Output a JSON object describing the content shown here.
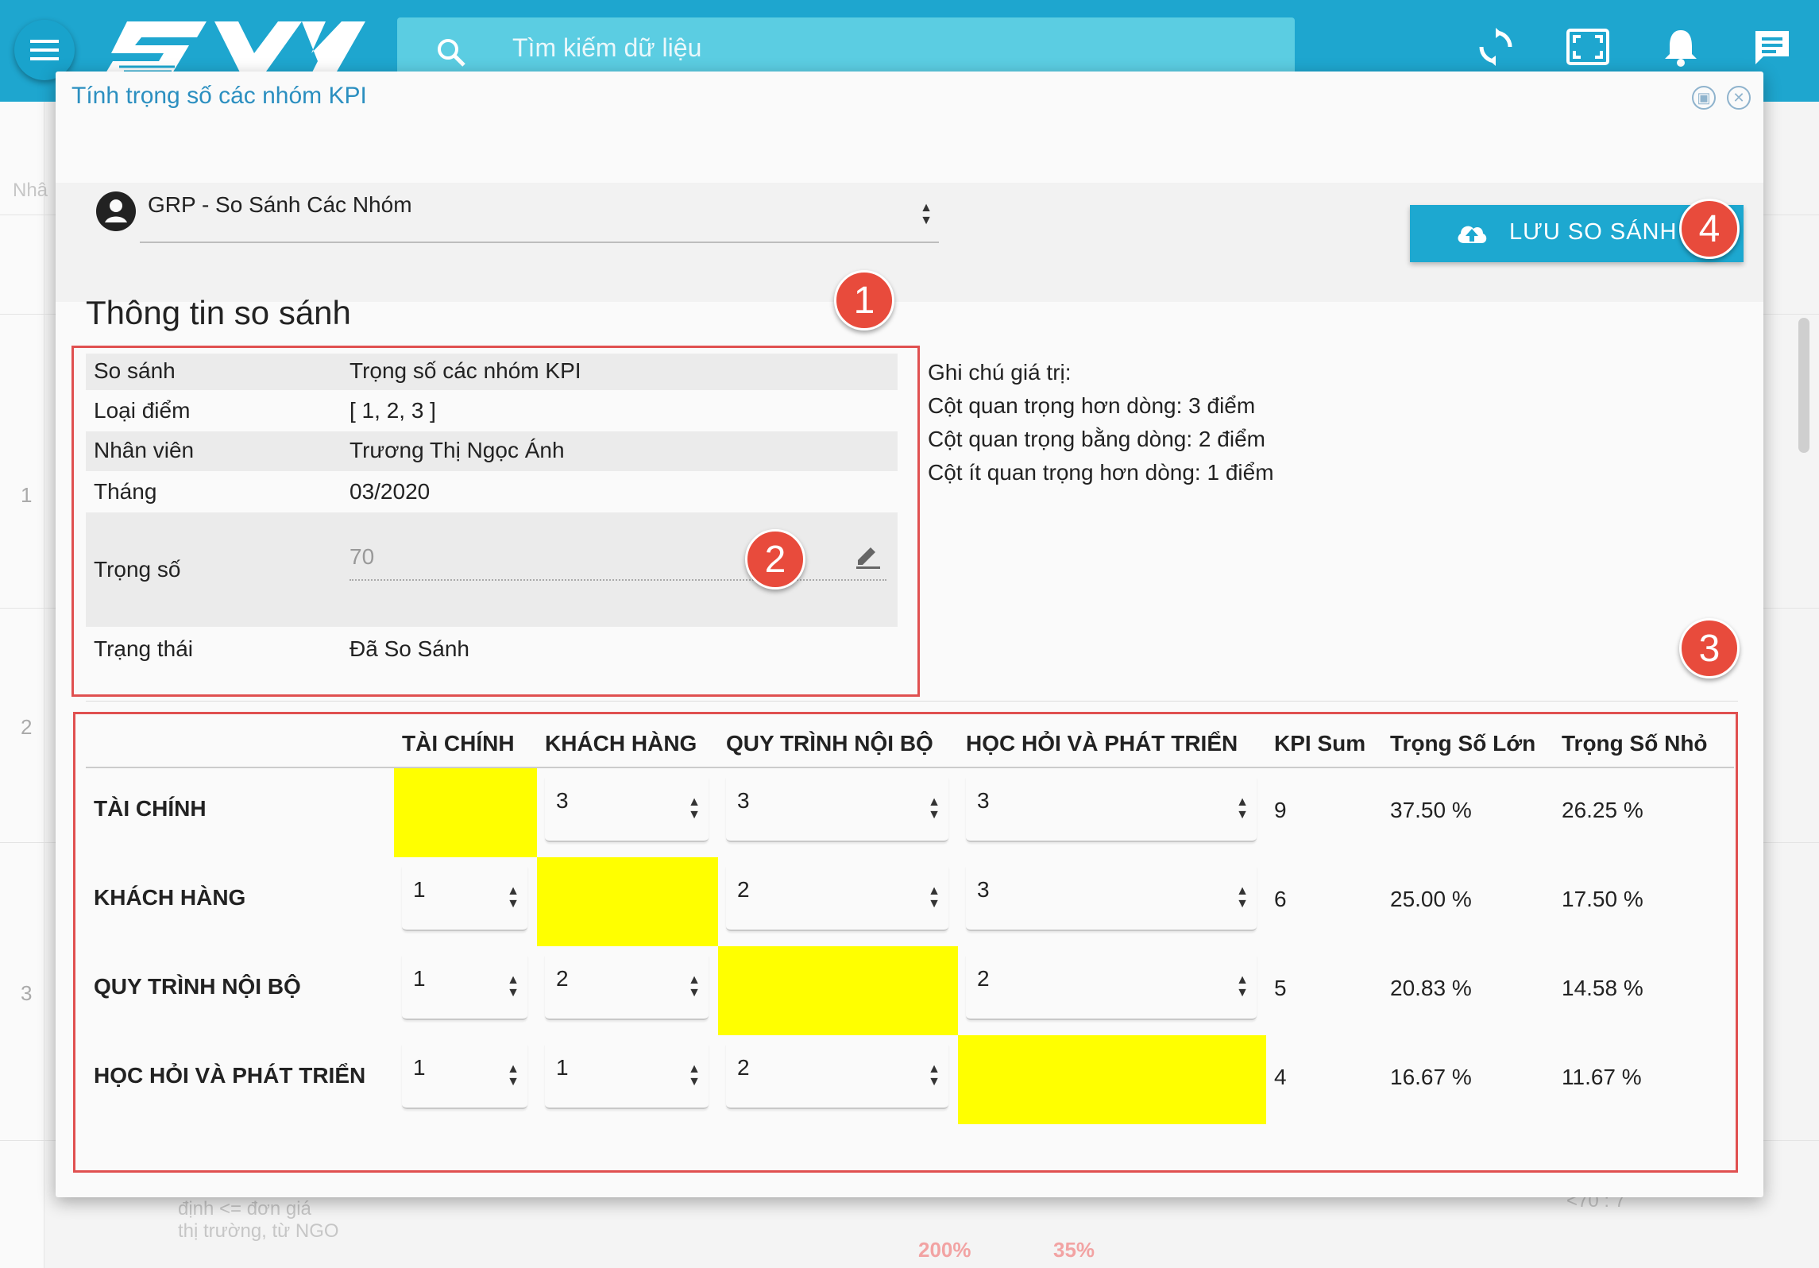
{
  "header": {
    "search_placeholder": "Tìm kiếm dữ liệu",
    "icons": [
      "menu-icon",
      "refresh-icon",
      "fullscreen-icon",
      "bell-icon",
      "chat-icon"
    ]
  },
  "background": {
    "row_numbers": [
      "1",
      "2",
      "3"
    ],
    "partial_label": "Nhâ",
    "footer_texts": [
      "định <= đơn giá",
      "thị trường, từ NGO"
    ],
    "right_partial": "<70 : 7",
    "percentages": [
      "200%",
      "35%"
    ]
  },
  "modal": {
    "title": "Tính trọng số các nhóm KPI",
    "group_select": "GRP - So Sánh Các Nhóm",
    "save_button": "LƯU SO SÁNH",
    "section_title": "Thông tin so sánh",
    "info": {
      "compare_label": "So sánh",
      "compare_value": "Trọng số các nhóm KPI",
      "score_type_label": "Loại điểm",
      "score_type_value": "[ 1, 2, 3 ]",
      "employee_label": "Nhân viên",
      "employee_value": "Trương Thị Ngọc Ánh",
      "month_label": "Tháng",
      "month_value": "03/2020",
      "weight_label": "Trọng số",
      "weight_value": "70",
      "status_label": "Trạng thái",
      "status_value": "Đã So Sánh"
    },
    "notes": [
      "Ghi chú giá trị:",
      "Cột quan trọng hơn dòng: 3 điểm",
      "Cột quan trọng bằng dòng: 2 điểm",
      "Cột ít quan trọng hơn dòng: 1 điểm"
    ],
    "badges": [
      "1",
      "2",
      "3",
      "4"
    ]
  },
  "kpi_table": {
    "columns": [
      "TÀI CHÍNH",
      "KHÁCH HÀNG",
      "QUY TRÌNH NỘI BỘ",
      "HỌC HỎI VÀ PHÁT TRIỂN",
      "KPI Sum",
      "Trọng Số Lớn",
      "Trọng Số Nhỏ"
    ],
    "rows": [
      {
        "label": "TÀI CHÍNH",
        "cells": [
          "",
          "3",
          "3",
          "3"
        ],
        "sum": "9",
        "big": "37.50 %",
        "small": "26.25 %"
      },
      {
        "label": "KHÁCH HÀNG",
        "cells": [
          "1",
          "",
          "2",
          "3"
        ],
        "sum": "6",
        "big": "25.00 %",
        "small": "17.50 %"
      },
      {
        "label": "QUY TRÌNH NỘI BỘ",
        "cells": [
          "1",
          "2",
          "",
          "2"
        ],
        "sum": "5",
        "big": "20.83 %",
        "small": "14.58 %"
      },
      {
        "label": "HỌC HỎI VÀ PHÁT TRIỂN",
        "cells": [
          "1",
          "1",
          "2",
          ""
        ],
        "sum": "4",
        "big": "16.67 %",
        "small": "11.67 %"
      }
    ],
    "diagonal_color": "#ffff00"
  }
}
